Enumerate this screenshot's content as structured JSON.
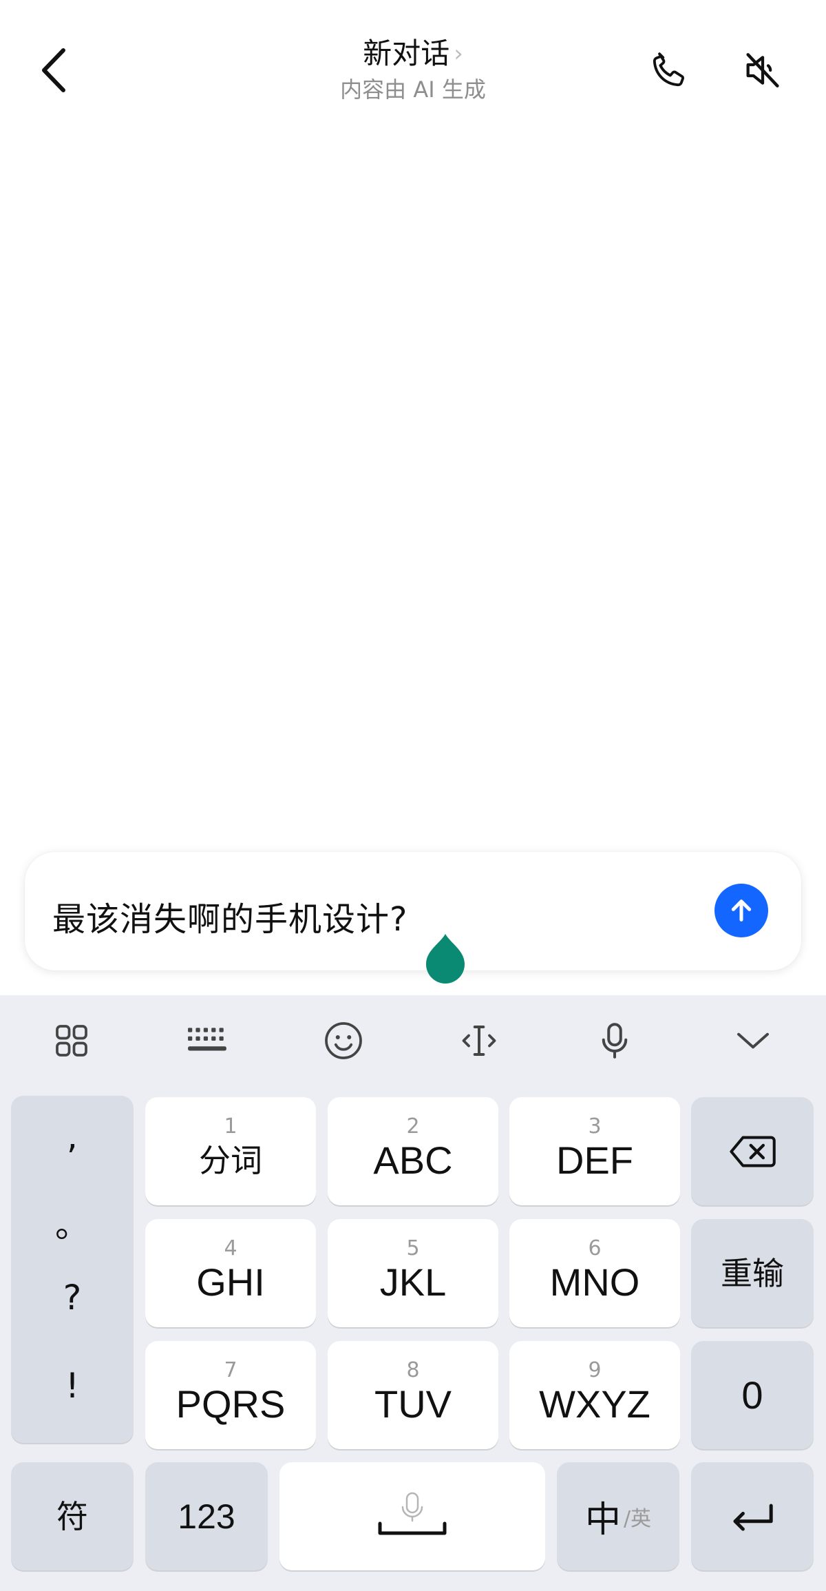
{
  "header": {
    "title": "新对话",
    "title_chevron": "›",
    "subtitle": "内容由 AI 生成",
    "back_icon": "chevron-left-icon",
    "call_icon": "phone-icon",
    "mute_icon": "speaker-muted-icon"
  },
  "composer": {
    "text": "最该消失啊的手机设计?",
    "send_icon": "arrow-up-icon",
    "send_color": "#1366ff",
    "caret_handle_color": "#0a8a72"
  },
  "keyboard": {
    "toolbar": [
      "apps-grid-icon",
      "keyboard-icon",
      "emoji-icon",
      "cursor-icon",
      "microphone-icon",
      "collapse-chevron-icon"
    ],
    "punctuation": [
      ",",
      "。",
      "?",
      "!"
    ],
    "keys": [
      {
        "num": "1",
        "label": "分词"
      },
      {
        "num": "2",
        "label": "ABC"
      },
      {
        "num": "3",
        "label": "DEF"
      },
      {
        "num": "4",
        "label": "GHI"
      },
      {
        "num": "5",
        "label": "JKL"
      },
      {
        "num": "6",
        "label": "MNO"
      },
      {
        "num": "7",
        "label": "PQRS"
      },
      {
        "num": "8",
        "label": "TUV"
      },
      {
        "num": "9",
        "label": "WXYZ"
      }
    ],
    "retype": "重输",
    "zero": "0",
    "symbol": "符",
    "numbers": "123",
    "lang_zh": "中",
    "lang_en": "/英",
    "backspace_icon": "backspace-icon",
    "enter_icon": "enter-icon",
    "space_icon": "space-microphone-icon"
  }
}
